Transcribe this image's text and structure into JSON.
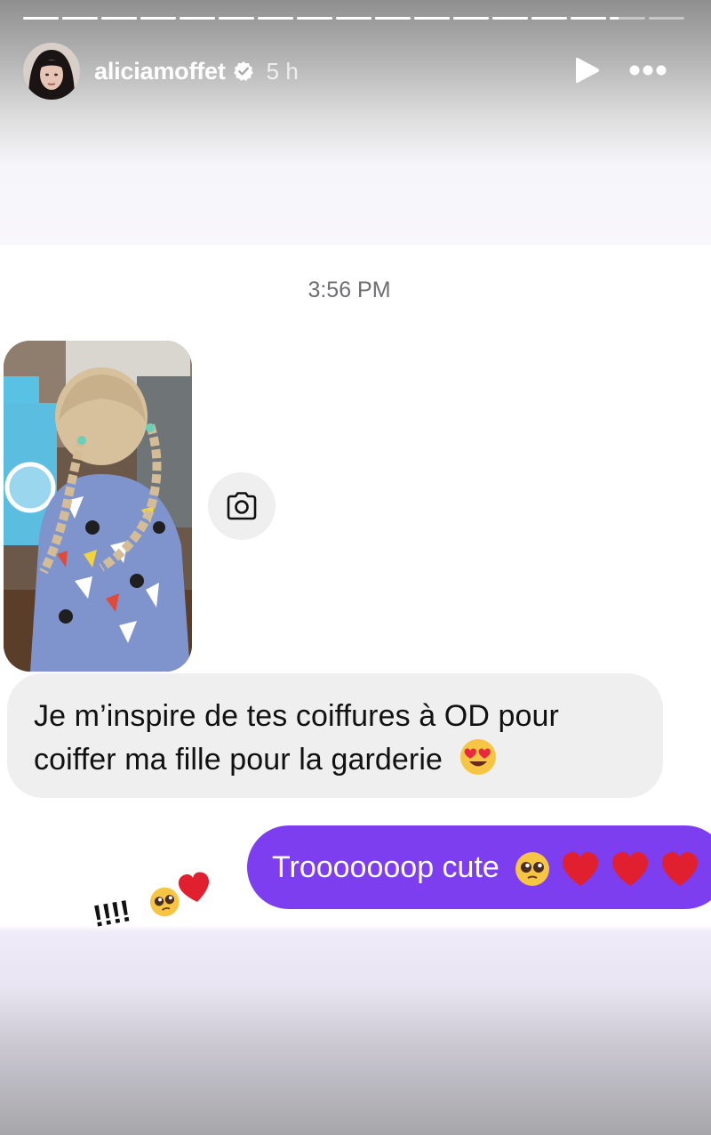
{
  "story": {
    "username": "aliciamoffet",
    "time_ago": "5 h",
    "segments_total": 17,
    "segments_completed": 15,
    "current_segment_progress": 0.25,
    "icons": {
      "verified": "verified-badge-icon",
      "play": "play-icon",
      "more": "more-options-icon"
    }
  },
  "chat": {
    "timestamp": "3:56 PM",
    "received_message": "Je m’inspire de tes coiffures à OD pour coiffer ma fille pour la garderie",
    "received_emoji": "heart-eyes-emoji",
    "sent_message": "Trooooooop cute",
    "sent_emojis": [
      "pleading-face-emoji",
      "red-heart-emoji",
      "red-heart-emoji",
      "red-heart-emoji"
    ],
    "sent_bubble_color": "#7d3ef0",
    "photo": "photo-of-child-with-braids"
  },
  "sticker": {
    "text": "!!!!",
    "emojis": [
      "pleading-face-emoji",
      "red-heart-emoji"
    ]
  }
}
